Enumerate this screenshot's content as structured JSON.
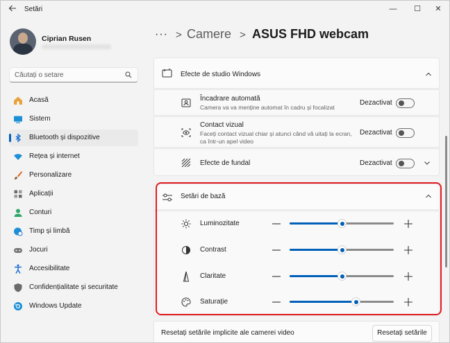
{
  "window": {
    "title": "Setări",
    "controls": {
      "minimize": "—",
      "maximize": "☐",
      "close": "✕"
    }
  },
  "profile": {
    "name": "Ciprian Rusen"
  },
  "search": {
    "placeholder": "Căutați o setare"
  },
  "sidebar": {
    "items": [
      {
        "label": "Acasă",
        "icon": "home-icon",
        "color": "#e8a33d"
      },
      {
        "label": "Sistem",
        "icon": "system-icon",
        "color": "#1c8fd6"
      },
      {
        "label": "Bluetooth și dispozitive",
        "icon": "bluetooth-icon",
        "color": "#1c6fd6",
        "selected": true
      },
      {
        "label": "Rețea și internet",
        "icon": "wifi-icon",
        "color": "#1c8fd6"
      },
      {
        "label": "Personalizare",
        "icon": "brush-icon",
        "color": "#d6651c"
      },
      {
        "label": "Aplicații",
        "icon": "apps-icon",
        "color": "#6b6b6b"
      },
      {
        "label": "Conturi",
        "icon": "account-icon",
        "color": "#2ea86a"
      },
      {
        "label": "Timp și limbă",
        "icon": "globe-clock-icon",
        "color": "#1c8fd6"
      },
      {
        "label": "Jocuri",
        "icon": "gamepad-icon",
        "color": "#777777"
      },
      {
        "label": "Accesibilitate",
        "icon": "accessibility-icon",
        "color": "#1c6fd6"
      },
      {
        "label": "Confidențialitate și securitate",
        "icon": "shield-icon",
        "color": "#6b6b6b"
      },
      {
        "label": "Windows Update",
        "icon": "update-icon",
        "color": "#1c8fd6"
      }
    ]
  },
  "breadcrumb": {
    "more": "···",
    "separator": ">",
    "parent": "Camere",
    "current": "ASUS FHD webcam"
  },
  "studio_effects": {
    "title": "Efecte de studio Windows",
    "rows": [
      {
        "title": "Încadrare automată",
        "description": "Camera va va menține automat în cadru și focalizat",
        "status": "Dezactivat",
        "on": false
      },
      {
        "title": "Contact vizual",
        "description": "Faceți contact vizual chiar și atunci când vă uitați la ecran, ca într-un apel video",
        "status": "Dezactivat",
        "on": false
      },
      {
        "title": "Efecte de fundal",
        "status": "Dezactivat",
        "on": false
      }
    ]
  },
  "basic_settings": {
    "title": "Setări de bază",
    "sliders": [
      {
        "label": "Luminozitate",
        "icon": "brightness-icon",
        "value": 0.5
      },
      {
        "label": "Contrast",
        "icon": "contrast-icon",
        "value": 0.5
      },
      {
        "label": "Claritate",
        "icon": "sharpness-icon",
        "value": 0.5
      },
      {
        "label": "Saturație",
        "icon": "palette-icon",
        "value": 0.63
      }
    ]
  },
  "reset": {
    "label": "Resetați setările implicite ale camerei video",
    "button": "Resetați setările"
  },
  "colors": {
    "accent": "#005fb8",
    "highlight": "#e0191e"
  }
}
